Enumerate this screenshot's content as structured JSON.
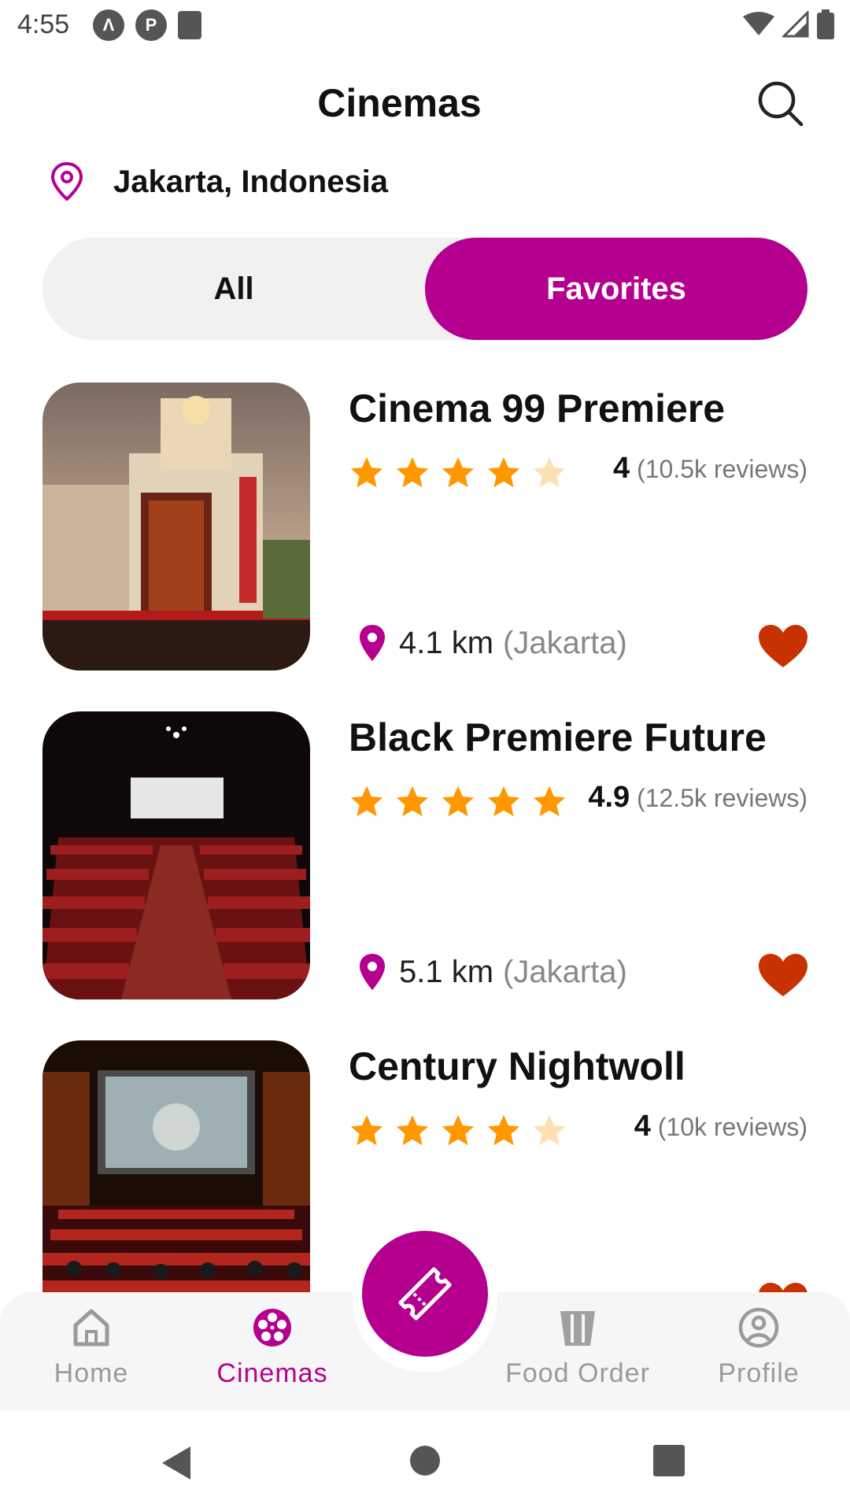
{
  "status_bar": {
    "time": "4:55",
    "left_icons": [
      "a-icon",
      "p-icon",
      "sd-card-icon"
    ],
    "right_icons": [
      "wifi-icon",
      "signal-icon",
      "battery-icon"
    ]
  },
  "header": {
    "title": "Cinemas",
    "search_icon": "search-icon"
  },
  "location": {
    "icon": "location-pin-icon",
    "text": "Jakarta, Indonesia"
  },
  "segmented": {
    "all_label": "All",
    "favorites_label": "Favorites",
    "selected": "Favorites"
  },
  "cinemas": [
    {
      "name": "Cinema 99 Premiere",
      "rating": "4",
      "stars_filled": 4,
      "reviews": "(10.5k reviews)",
      "distance": "4.1 km",
      "city": "(Jakarta)",
      "favorited": true
    },
    {
      "name": "Black Premiere Future",
      "rating": "4.9",
      "stars_filled": 5,
      "reviews": "(12.5k reviews)",
      "distance": "5.1 km",
      "city": "(Jakarta)",
      "favorited": true
    },
    {
      "name": "Century Nightwoll",
      "rating": "4",
      "stars_filled": 4,
      "reviews": "(10k reviews)",
      "distance": "",
      "city": "",
      "favorited": true
    }
  ],
  "bottom_nav": {
    "items": [
      {
        "label": "Home",
        "icon": "home-icon",
        "active": false
      },
      {
        "label": "Cinemas",
        "icon": "film-reel-icon",
        "active": true
      },
      {
        "label": "Food Order",
        "icon": "popcorn-icon",
        "active": false
      },
      {
        "label": "Profile",
        "icon": "profile-icon",
        "active": false
      }
    ],
    "fab_icon": "ticket-icon"
  },
  "colors": {
    "accent": "#b5008f",
    "star": "#ff9800",
    "star_empty": "#ffe0b2",
    "heart": "#c83200",
    "segment_bg": "#f2f1f0"
  }
}
